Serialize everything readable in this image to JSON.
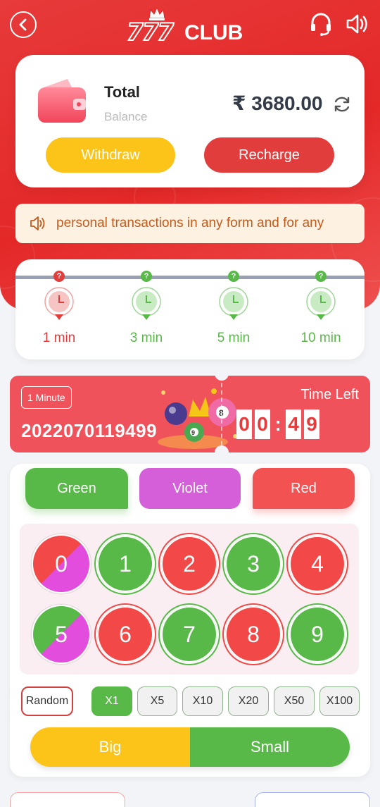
{
  "header": {
    "logo_num": "777",
    "logo_text": "CLUB"
  },
  "wallet": {
    "title": "Total",
    "subtitle": "Balance",
    "amount": "₹ 3680.00",
    "withdraw_label": "Withdraw",
    "recharge_label": "Recharge"
  },
  "notice": {
    "text": "personal transactions in any form and for any"
  },
  "modes": [
    {
      "label": "1 min",
      "active": true
    },
    {
      "label": "3 min",
      "active": false
    },
    {
      "label": "5 min",
      "active": false
    },
    {
      "label": "10 min",
      "active": false
    }
  ],
  "timer": {
    "tag": "1 Minute",
    "period": "2022070119499",
    "time_left_label": "Time Left",
    "digits": [
      "0",
      "0",
      ":",
      "4",
      "9"
    ]
  },
  "colors": {
    "green": "Green",
    "violet": "Violet",
    "red": "Red"
  },
  "numbers": [
    "0",
    "1",
    "2",
    "3",
    "4",
    "5",
    "6",
    "7",
    "8",
    "9"
  ],
  "random_label": "Random",
  "multipliers": [
    "X1",
    "X5",
    "X10",
    "X20",
    "X50",
    "X100"
  ],
  "big_label": "Big",
  "small_label": "Small",
  "palette": {
    "red": "#e42828",
    "green": "#58b948",
    "violet": "#d45fd8",
    "yellow": "#fcc419"
  }
}
